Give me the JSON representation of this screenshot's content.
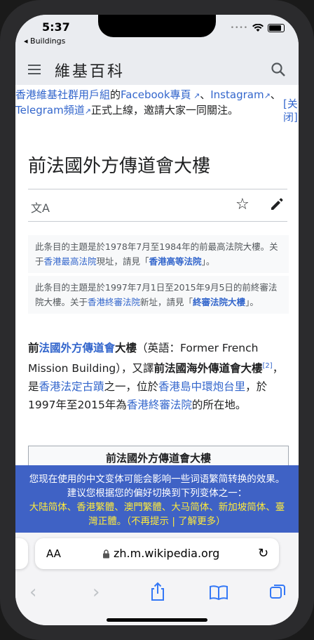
{
  "status": {
    "time": "5:37",
    "back_app": "◂ Buildings"
  },
  "header": {
    "logo": "維基百科"
  },
  "banner": {
    "line_parts": [
      "香港維基社群用戶組",
      "的",
      "Facebook專頁",
      "、",
      "Instagram",
      "、",
      "Telegram頻道",
      "正式上線，邀請大家一同關注。"
    ],
    "close_label": "[关闭]"
  },
  "article": {
    "title": "前法國外方傳道會大樓",
    "hatnote1": {
      "text1": "此条目的主題是於1978年7月至1984年的前最高法院大樓。关于",
      "link1": "香港最高法院",
      "text2": "現址，請見「",
      "link2": "香港高等法院",
      "text3": "」。"
    },
    "hatnote2": {
      "text1": "此条目的主題是於1997年7月1日至2015年9月5日的前終審法院大樓。关于",
      "link1": "香港終審法院",
      "text2": "新址，請見「",
      "link2": "終審法院大樓",
      "text3": "」。"
    },
    "para": {
      "b1": "前",
      "l1": "法國外方傳道會",
      "b2": "大樓",
      "t1": "（英語：Former French Mission Building），又譯",
      "b3": "前法國海外傳道會大樓",
      "ref": "[2]",
      "t2": "，是",
      "l2": "香港法定古蹟",
      "t3": "之一，位於",
      "l3": "香港島",
      "l4": "中環",
      "l5": "炮台里",
      "t4": "，於1997年至2015年為",
      "l6": "香港終審法院",
      "t5": "的所在地。"
    },
    "infobox_title": "前法國外方傳道會大樓"
  },
  "notice": {
    "text": "您现在使用的中文变体可能会影响一些词语繁简转换的效果。建议您根据您的偏好切换到下列变体之一：",
    "variants": "大陆简体、香港繁體、澳門繁體、大马简体、新加坡简体、臺灣正體。",
    "actions": "（不再提示 | 了解更多）"
  },
  "safari": {
    "aa_label": "AA",
    "url": "zh.m.wikipedia.org"
  },
  "icons": [
    "hamburger-icon",
    "search-icon",
    "translate-icon",
    "star-icon",
    "edit-icon",
    "lock-icon",
    "reload-icon",
    "back-icon",
    "forward-icon",
    "share-icon",
    "bookmarks-icon",
    "tabs-icon",
    "wifi-icon",
    "battery-icon"
  ]
}
